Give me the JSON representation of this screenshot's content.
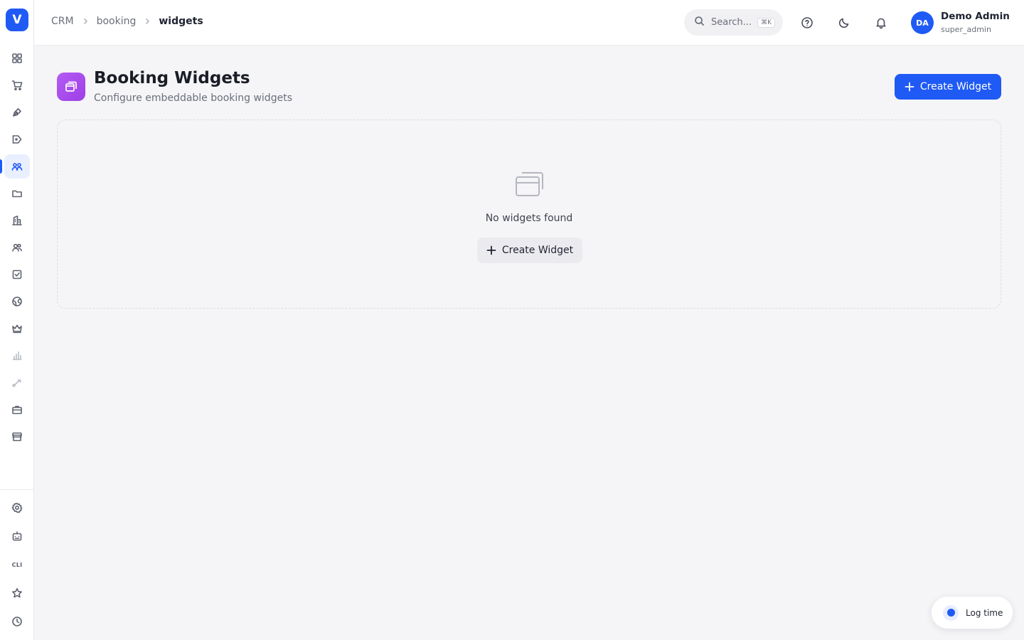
{
  "app": {
    "logo_letter": "V",
    "accent": "#1f5af5"
  },
  "sidebar": {
    "items": [
      {
        "name": "dashboard-icon"
      },
      {
        "name": "cart-icon"
      },
      {
        "name": "pen-tool-icon"
      },
      {
        "name": "megaphone-icon"
      },
      {
        "name": "users-icon",
        "active": true
      },
      {
        "name": "folder-icon"
      },
      {
        "name": "building-icon"
      },
      {
        "name": "contacts-icon"
      },
      {
        "name": "checkbox-icon"
      },
      {
        "name": "globe-icon"
      },
      {
        "name": "crown-icon"
      },
      {
        "name": "bar-chart-icon"
      },
      {
        "name": "route-icon"
      },
      {
        "name": "briefcase-icon"
      },
      {
        "name": "store-icon"
      }
    ],
    "bottom_items": [
      {
        "name": "settings-icon"
      },
      {
        "name": "robot-icon"
      },
      {
        "name": "cli-icon",
        "label": "CLI"
      },
      {
        "name": "star-icon"
      },
      {
        "name": "clock-icon"
      }
    ]
  },
  "header": {
    "breadcrumb": [
      "CRM",
      "booking",
      "widgets"
    ],
    "search": {
      "placeholder": "Search...",
      "shortcut": "⌘K"
    },
    "user": {
      "initials": "DA",
      "name": "Demo Admin",
      "role": "super_admin"
    }
  },
  "page": {
    "title": "Booking Widgets",
    "subtitle": "Configure embeddable booking widgets",
    "create_button": "Create Widget",
    "icon_color": "#a64cec"
  },
  "empty_state": {
    "message": "No widgets found",
    "button": "Create Widget"
  },
  "log_time": {
    "label": "Log time"
  }
}
